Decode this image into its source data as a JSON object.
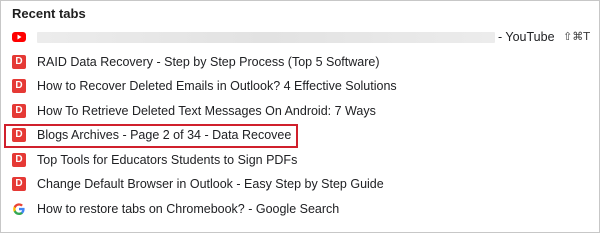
{
  "header": {
    "title": "Recent tabs"
  },
  "tabs": [
    {
      "favicon": "youtube-icon",
      "title": "",
      "suffix": "- YouTube",
      "shortcut": "⇧⌘T",
      "title_blurred": true
    },
    {
      "favicon": "data-recovee-icon",
      "favicon_letter": "D",
      "title": "RAID Data Recovery - Step by Step Process (Top 5 Software)"
    },
    {
      "favicon": "data-recovee-icon",
      "favicon_letter": "D",
      "title": "How to Recover Deleted Emails in Outlook? 4 Effective Solutions"
    },
    {
      "favicon": "data-recovee-icon",
      "favicon_letter": "D",
      "title": "How To Retrieve Deleted Text Messages On Android: 7 Ways"
    },
    {
      "favicon": "data-recovee-icon",
      "favicon_letter": "D",
      "title": "Blogs Archives - Page 2 of 34 - Data Recovee",
      "highlighted": true
    },
    {
      "favicon": "data-recovee-icon",
      "favicon_letter": "D",
      "title": "Top Tools for Educators  Students to Sign PDFs"
    },
    {
      "favicon": "data-recovee-icon",
      "favicon_letter": "D",
      "title": "Change Default Browser in Outlook - Easy Step by Step Guide"
    },
    {
      "favicon": "google-icon",
      "favicon_letter": "G",
      "title": "How to restore tabs on Chromebook? - Google Search"
    }
  ],
  "colors": {
    "favicon_red": "#e53935",
    "highlight_border": "#d0202c",
    "youtube_red": "#ff0000"
  }
}
